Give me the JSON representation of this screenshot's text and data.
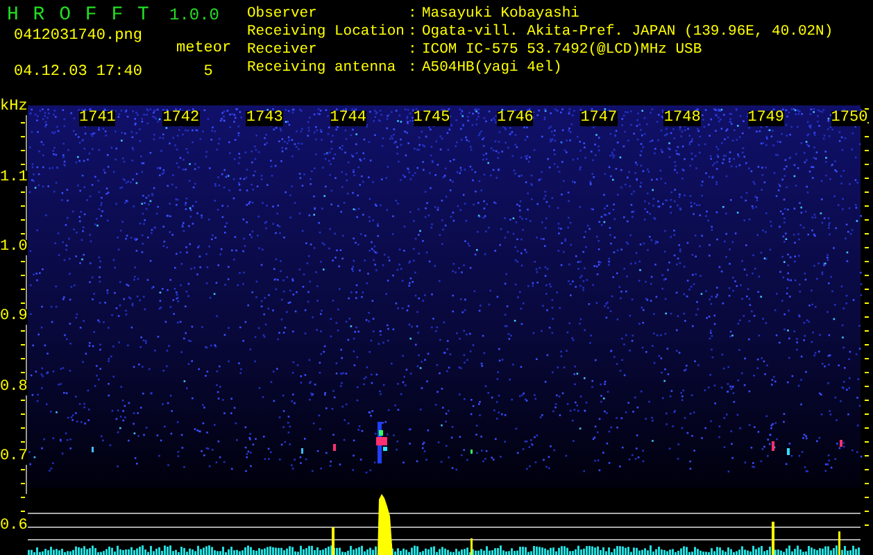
{
  "app": {
    "title": "H R O F F T",
    "version": "1.0.0"
  },
  "file": {
    "name": "0412031740.png",
    "datetime": "04.12.03 17:40"
  },
  "meteor": {
    "label": "meteor",
    "count": "5"
  },
  "station": [
    {
      "label": "Observer",
      "separator": ":",
      "value": "Masayuki Kobayashi"
    },
    {
      "label": "Receiving Location",
      "separator": ":",
      "value": "Ogata-vill. Akita-Pref. JAPAN (139.96E, 40.02N)"
    },
    {
      "label": "Receiver",
      "separator": ":",
      "value": "ICOM IC-575 53.7492(@LCD)MHz USB"
    },
    {
      "label": "Receiving antenna",
      "separator": ":",
      "value": "A504HB(yagi 4el)"
    }
  ],
  "plot": {
    "unit": "kHz",
    "time_labels": [
      "1741",
      "1742",
      "1743",
      "1744",
      "1745",
      "1746",
      "1747",
      "1748",
      "1749",
      "1750"
    ],
    "freq_labels": [
      "1.1",
      "1.0",
      "0.9",
      "0.8",
      "0.7",
      "0.6"
    ]
  }
}
